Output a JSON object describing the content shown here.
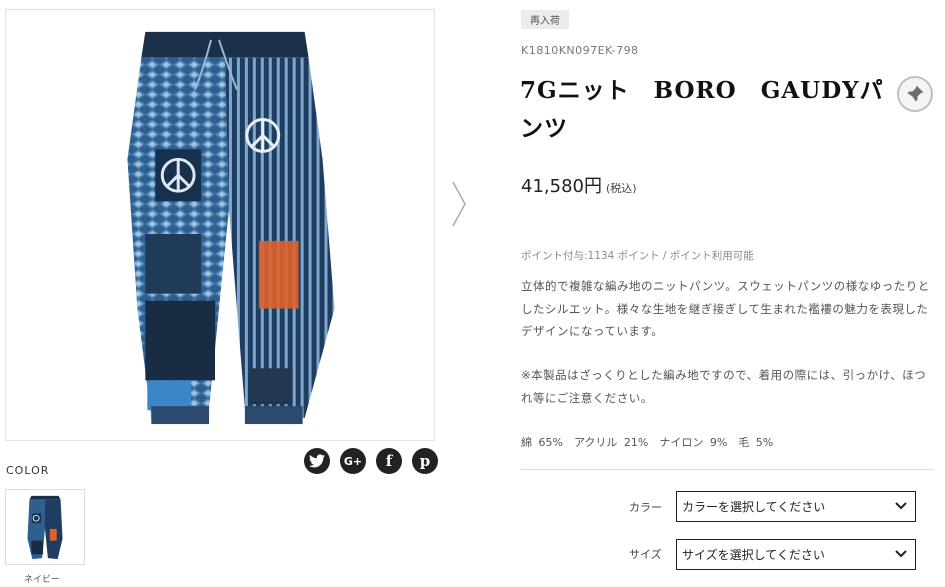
{
  "gallery": {
    "main_image_alt": "knit patchwork pants",
    "next_icon": "chevron-right-icon",
    "color_label": "COLOR",
    "thumbnail_caption": "ネイビー",
    "colors": {
      "denim_dark": "#1d3a5c",
      "denim_mid": "#3e6f9e",
      "denim_light": "#8fb5d6",
      "accent_orange": "#e0622a"
    }
  },
  "social": [
    {
      "name": "twitter",
      "glyph": "t"
    },
    {
      "name": "google-plus",
      "glyph": "G+"
    },
    {
      "name": "facebook",
      "glyph": "f"
    },
    {
      "name": "pinterest",
      "glyph": "p"
    }
  ],
  "product": {
    "badge": "再入荷",
    "sku": "K1810KN097EK-798",
    "title": "7Gニット　BORO　GAUDYパンツ",
    "price": "41,580円",
    "tax_note": "(税込)",
    "points_note": "ポイント付与:1134 ポイント / ポイント利用可能",
    "description": "立体的で複雑な編み地のニットパンツ。スウェットパンツの様なゆったりとしたシルエット。様々な生地を継ぎ接ぎして生まれた襤褸の魅力を表現したデザインになっています。",
    "note": "※本製品はざっくりとした編み地ですので、着用の際には、引っかけ、ほつれ等にご注意ください。",
    "material": "綿 65%　アクリル 21%　ナイロン 9%　毛 5%"
  },
  "options": {
    "color_label": "カラー",
    "color_placeholder": "カラーを選択してください",
    "size_label": "サイズ",
    "size_placeholder": "サイズを選択してください"
  }
}
